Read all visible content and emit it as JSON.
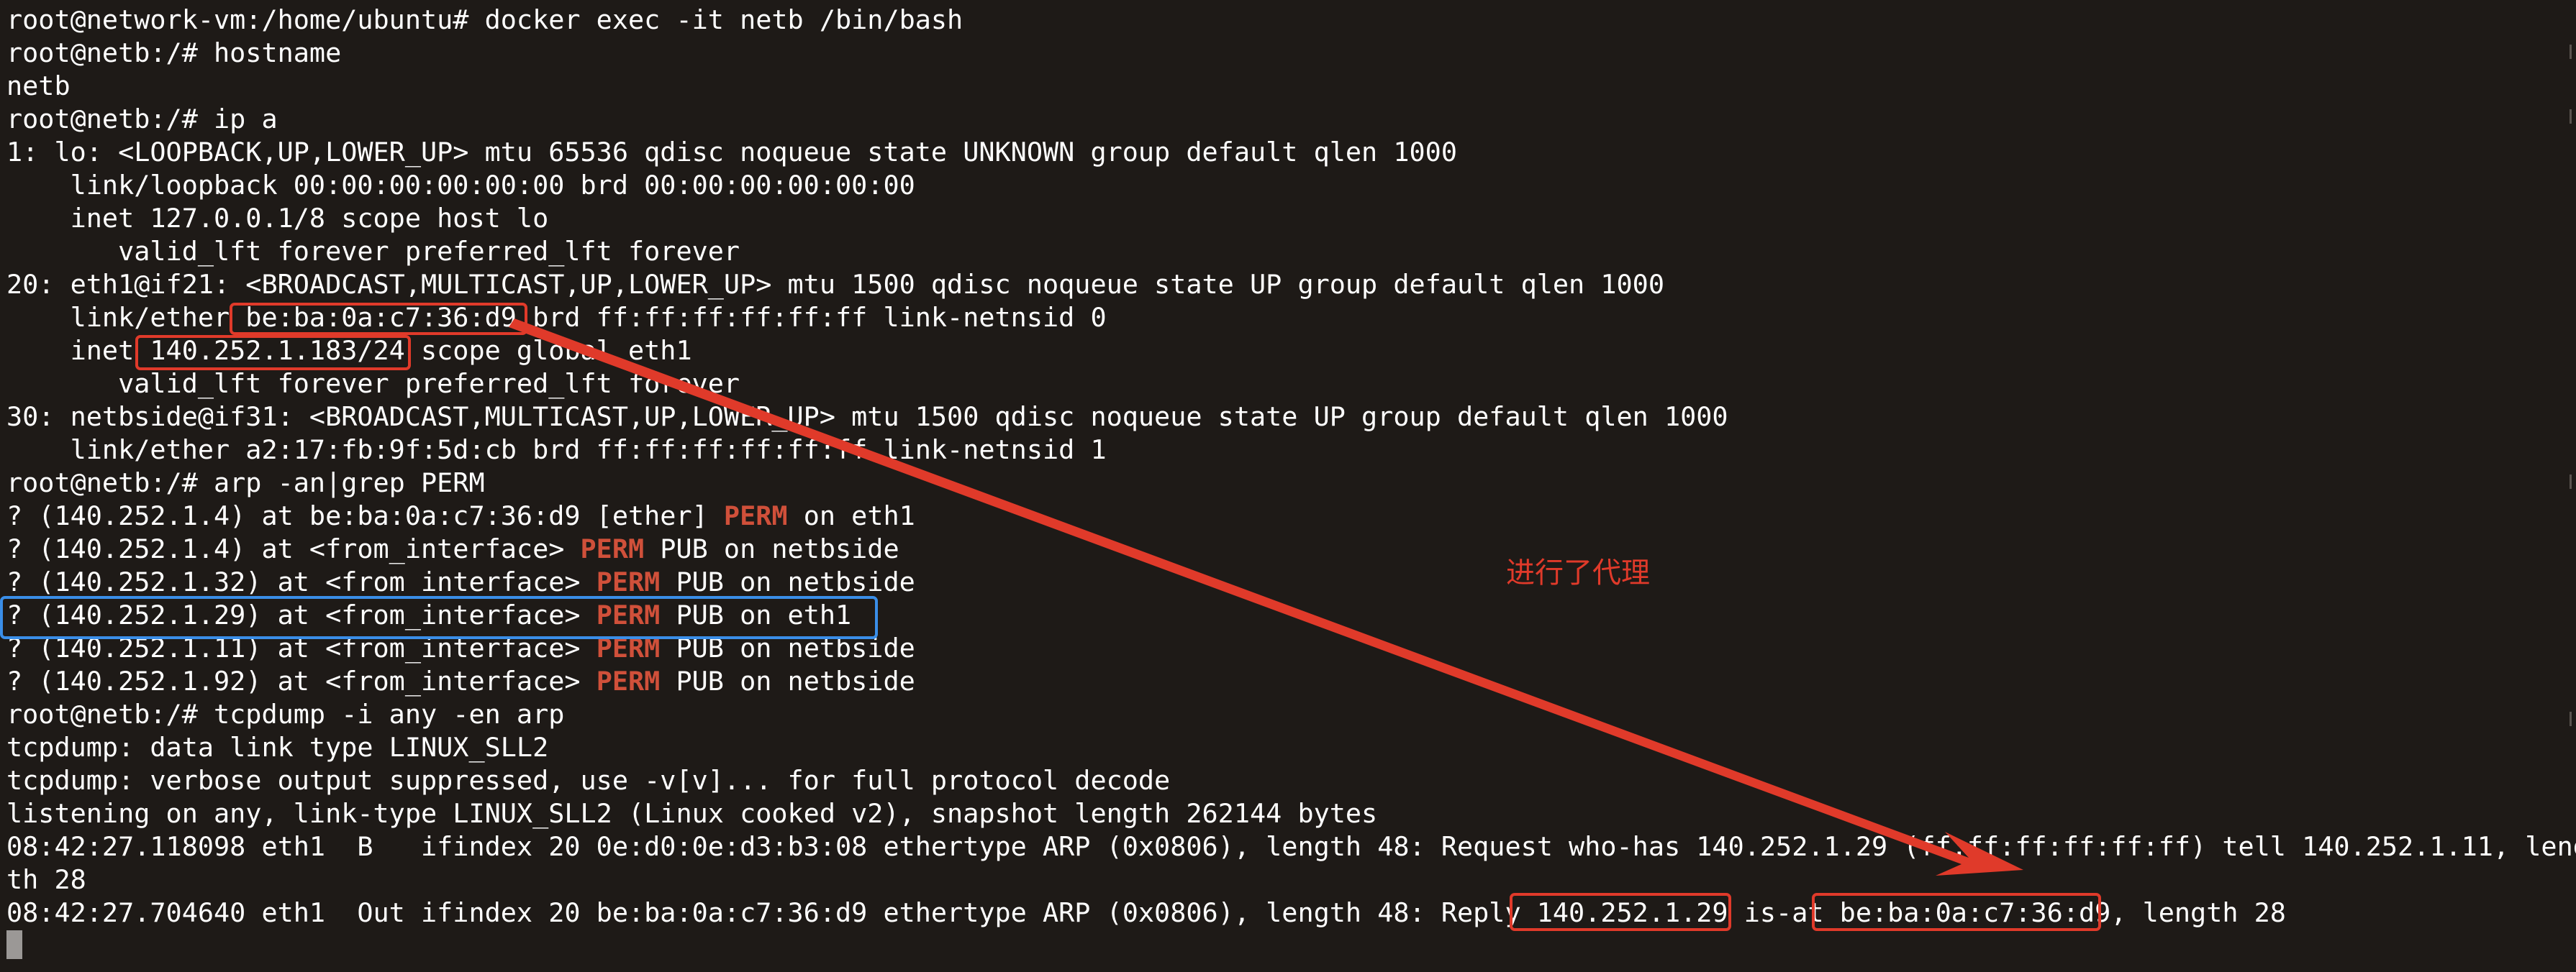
{
  "terminal": {
    "lines": [
      [
        {
          "t": "root@network-vm:/home/ubuntu# docker exec -it netb /bin/bash"
        }
      ],
      [
        {
          "t": "root@netb:/# hostname"
        }
      ],
      [
        {
          "t": "netb"
        }
      ],
      [
        {
          "t": "root@netb:/# ip a"
        }
      ],
      [
        {
          "t": "1: lo: <LOOPBACK,UP,LOWER_UP> mtu 65536 qdisc noqueue state UNKNOWN group default qlen 1000"
        }
      ],
      [
        {
          "t": "    link/loopback 00:00:00:00:00:00 brd 00:00:00:00:00:00"
        }
      ],
      [
        {
          "t": "    inet 127.0.0.1/8 scope host lo"
        }
      ],
      [
        {
          "t": "       valid_lft forever preferred_lft forever"
        }
      ],
      [
        {
          "t": "20: eth1@if21: <BROADCAST,MULTICAST,UP,LOWER_UP> mtu 1500 qdisc noqueue state UP group default qlen 1000"
        }
      ],
      [
        {
          "t": "    link/ether be:ba:0a:c7:36:d9 brd ff:ff:ff:ff:ff:ff link-netnsid 0"
        }
      ],
      [
        {
          "t": "    inet 140.252.1.183/24 scope global eth1"
        }
      ],
      [
        {
          "t": "       valid_lft forever preferred_lft forever"
        }
      ],
      [
        {
          "t": "30: netbside@if31: <BROADCAST,MULTICAST,UP,LOWER_UP> mtu 1500 qdisc noqueue state UP group default qlen 1000"
        }
      ],
      [
        {
          "t": "    link/ether a2:17:fb:9f:5d:cb brd ff:ff:ff:ff:ff:ff link-netnsid 1"
        }
      ],
      [
        {
          "t": "root@netb:/# arp -an|grep PERM"
        }
      ],
      [
        {
          "t": "? (140.252.1.4) at be:ba:0a:c7:36:d9 [ether] "
        },
        {
          "t": "PERM",
          "hl": true
        },
        {
          "t": " on eth1"
        }
      ],
      [
        {
          "t": "? (140.252.1.4) at <from_interface> "
        },
        {
          "t": "PERM",
          "hl": true
        },
        {
          "t": " PUB on netbside"
        }
      ],
      [
        {
          "t": "? (140.252.1.32) at <from_interface> "
        },
        {
          "t": "PERM",
          "hl": true
        },
        {
          "t": " PUB on netbside"
        }
      ],
      [
        {
          "t": "? (140.252.1.29) at <from_interface> "
        },
        {
          "t": "PERM",
          "hl": true
        },
        {
          "t": " PUB on eth1"
        }
      ],
      [
        {
          "t": "? (140.252.1.11) at <from_interface> "
        },
        {
          "t": "PERM",
          "hl": true
        },
        {
          "t": " PUB on netbside"
        }
      ],
      [
        {
          "t": "? (140.252.1.92) at <from_interface> "
        },
        {
          "t": "PERM",
          "hl": true
        },
        {
          "t": " PUB on netbside"
        }
      ],
      [
        {
          "t": "root@netb:/# tcpdump -i any -en arp"
        }
      ],
      [
        {
          "t": "tcpdump: data link type LINUX_SLL2"
        }
      ],
      [
        {
          "t": "tcpdump: verbose output suppressed, use -v[v]... for full protocol decode"
        }
      ],
      [
        {
          "t": "listening on any, link-type LINUX_SLL2 (Linux cooked v2), snapshot length 262144 bytes"
        }
      ],
      [
        {
          "t": "08:42:27.118098 eth1  B   ifindex 20 0e:d0:0e:d3:b3:08 ethertype ARP (0x0806), length 48: Request who-has 140.252.1.29 (ff:ff:ff:ff:ff:ff) tell 140.252.1.11, leng"
        }
      ],
      [
        {
          "t": "th 28"
        }
      ],
      [
        {
          "t": "08:42:27.704640 eth1  Out ifindex 20 be:ba:0a:c7:36:d9 ethertype ARP (0x0806), length 48: Reply 140.252.1.29 is-at be:ba:0a:c7:36:d9, length 28"
        }
      ]
    ]
  },
  "annotation": {
    "note": "进行了代理",
    "red": "#e03a2a",
    "blue": "#3a8ee8"
  },
  "colors": {
    "background": "#1e1a17",
    "text": "#ffffff",
    "perm": "#d0503a"
  }
}
